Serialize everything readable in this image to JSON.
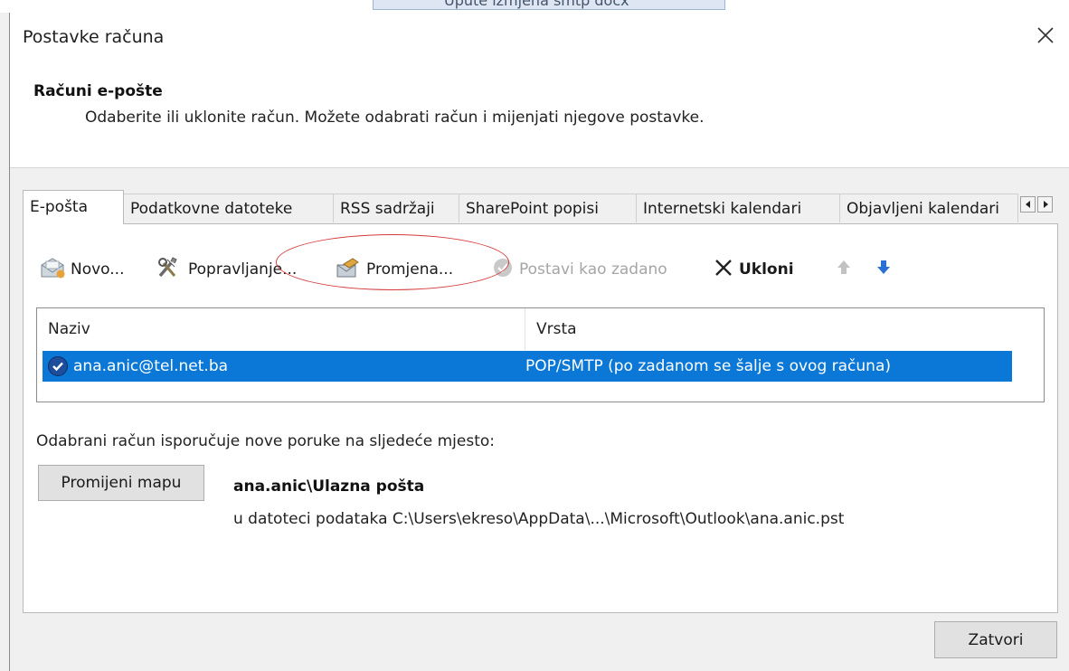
{
  "background": {
    "fragment": "Upute izmjena smtp docx"
  },
  "dialog": {
    "title": "Postavke računa",
    "close_glyph": "✕"
  },
  "header": {
    "section_title": "Računi e-pošte",
    "description": "Odaberite ili uklonite račun. Možete odabrati račun i mijenjati njegove postavke."
  },
  "tabs": [
    {
      "label": "E-pošta",
      "active": true
    },
    {
      "label": "Podatkovne datoteke"
    },
    {
      "label": "RSS sadržaji"
    },
    {
      "label": "SharePoint popisi"
    },
    {
      "label": "Internetski kalendari"
    },
    {
      "label": "Objavljeni kalendari"
    }
  ],
  "toolbar": {
    "new_label": "Novo...",
    "repair_label": "Popravljanje...",
    "change_label": "Promjena...",
    "set_default_label": "Postavi kao zadano",
    "remove_label": "Ukloni"
  },
  "accounts": {
    "columns": [
      "Naziv",
      "Vrsta"
    ],
    "rows": [
      {
        "name": "ana.anic@tel.net.ba",
        "type": "POP/SMTP (po zadanom se šalje s ovog računa)"
      }
    ]
  },
  "delivery": {
    "label": "Odabrani račun isporučuje nove poruke na sljedeće mjesto:",
    "change_folder_label": "Promijeni mapu",
    "folder": "ana.anic\\Ulazna pošta",
    "path": "u datoteci podataka C:\\Users\\ekreso\\AppData\\...\\Microsoft\\Outlook\\ana.anic.pst"
  },
  "footer": {
    "close_label": "Zatvori"
  },
  "colors": {
    "selection": "#0b78d7",
    "annotation": "#d63a3a",
    "accent_arrow": "#2a6fd6"
  }
}
